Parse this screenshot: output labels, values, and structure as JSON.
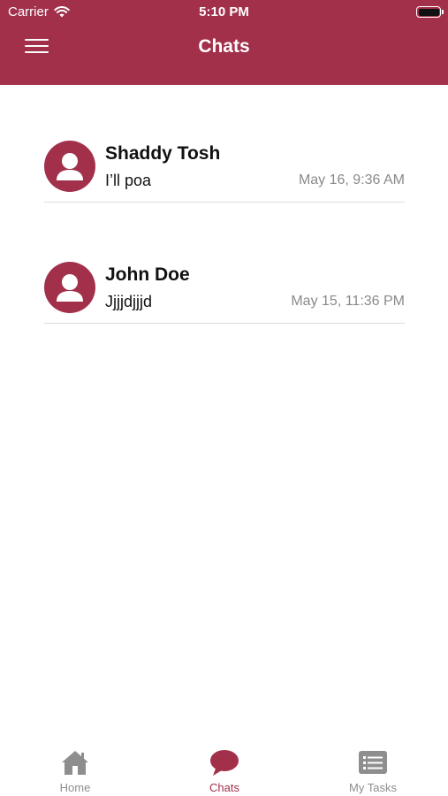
{
  "status_bar": {
    "carrier": "Carrier",
    "time": "5:10 PM"
  },
  "header": {
    "title": "Chats",
    "background_color": "#a3304b"
  },
  "chats": [
    {
      "name": "Shaddy Tosh",
      "last_message": "I’ll poa",
      "timestamp": "May 16, 9:36 AM"
    },
    {
      "name": "John Doe",
      "last_message": "Jjjjdjjjd",
      "timestamp": "May 15, 11:36 PM"
    }
  ],
  "tabbar": {
    "tabs": [
      {
        "label": "Home",
        "icon": "home-icon",
        "active": false
      },
      {
        "label": "Chats",
        "icon": "chat-bubble-icon",
        "active": true
      },
      {
        "label": "My Tasks",
        "icon": "task-list-icon",
        "active": false
      }
    ],
    "active_color": "#a3304b",
    "inactive_color": "#8e8e8e"
  }
}
